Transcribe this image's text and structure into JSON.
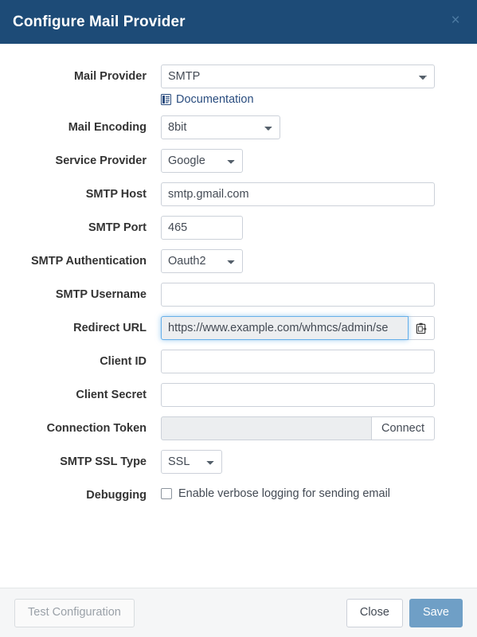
{
  "header": {
    "title": "Configure Mail Provider",
    "close_label": "×"
  },
  "form": {
    "mail_provider": {
      "label": "Mail Provider",
      "value": "SMTP",
      "options": [
        "SMTP"
      ]
    },
    "documentation": {
      "label": "Documentation",
      "icon": "document-icon"
    },
    "mail_encoding": {
      "label": "Mail Encoding",
      "value": "8bit",
      "options": [
        "8bit"
      ]
    },
    "service_provider": {
      "label": "Service Provider",
      "value": "Google",
      "options": [
        "Google"
      ]
    },
    "smtp_host": {
      "label": "SMTP Host",
      "value": "smtp.gmail.com",
      "placeholder": ""
    },
    "smtp_port": {
      "label": "SMTP Port",
      "value": "465",
      "placeholder": ""
    },
    "smtp_authentication": {
      "label": "SMTP Authentication",
      "value": "Oauth2",
      "options": [
        "Oauth2"
      ]
    },
    "smtp_username": {
      "label": "SMTP Username",
      "value": "",
      "placeholder": ""
    },
    "redirect_url": {
      "label": "Redirect URL",
      "value": "https://www.example.com/whmcs/admin/se",
      "copy_icon": "clipboard-copy-icon"
    },
    "client_id": {
      "label": "Client ID",
      "value": "",
      "placeholder": ""
    },
    "client_secret": {
      "label": "Client Secret",
      "value": "",
      "placeholder": ""
    },
    "connection_token": {
      "label": "Connection Token",
      "value": "",
      "placeholder": "",
      "connect_label": "Connect"
    },
    "smtp_ssl_type": {
      "label": "SMTP SSL Type",
      "value": "SSL",
      "options": [
        "SSL"
      ]
    },
    "debugging": {
      "label": "Debugging",
      "checkbox_label": "Enable verbose logging for sending email",
      "checked": false
    }
  },
  "footer": {
    "test_label": "Test Configuration",
    "close_label": "Close",
    "save_label": "Save"
  },
  "colors": {
    "header_blue": "#1d4b77",
    "save_blue": "#6f9fc6",
    "link_blue": "#2a4d7f",
    "focus_blue": "#66afe9"
  }
}
